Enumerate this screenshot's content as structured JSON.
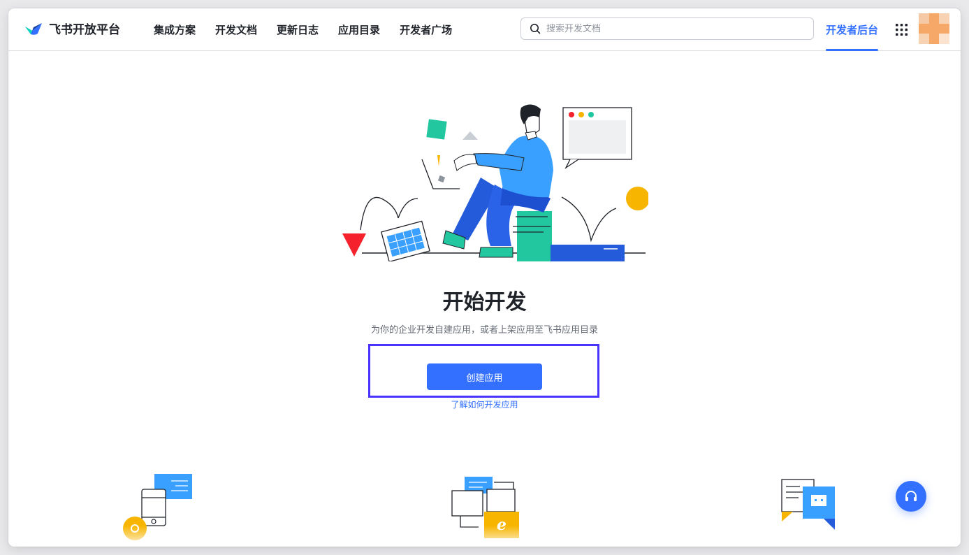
{
  "header": {
    "logo_text": "飞书开放平台",
    "nav": [
      "集成方案",
      "开发文档",
      "更新日志",
      "应用目录",
      "开发者广场"
    ],
    "search_placeholder": "搜索开发文档",
    "console_tab": "开发者后台"
  },
  "main": {
    "title": "开始开发",
    "subtitle": "为你的企业开发自建应用，或者上架应用至飞书应用目录",
    "create_button": "创建应用",
    "learn_link": "了解如何开发应用"
  },
  "colors": {
    "accent": "#3370ff",
    "highlight_border": "#4a32ff",
    "text_primary": "#1f2329",
    "text_secondary": "#646a73"
  },
  "icons": [
    "logo-icon",
    "search-icon",
    "apps-grid-icon",
    "avatar",
    "support-headset-icon"
  ]
}
